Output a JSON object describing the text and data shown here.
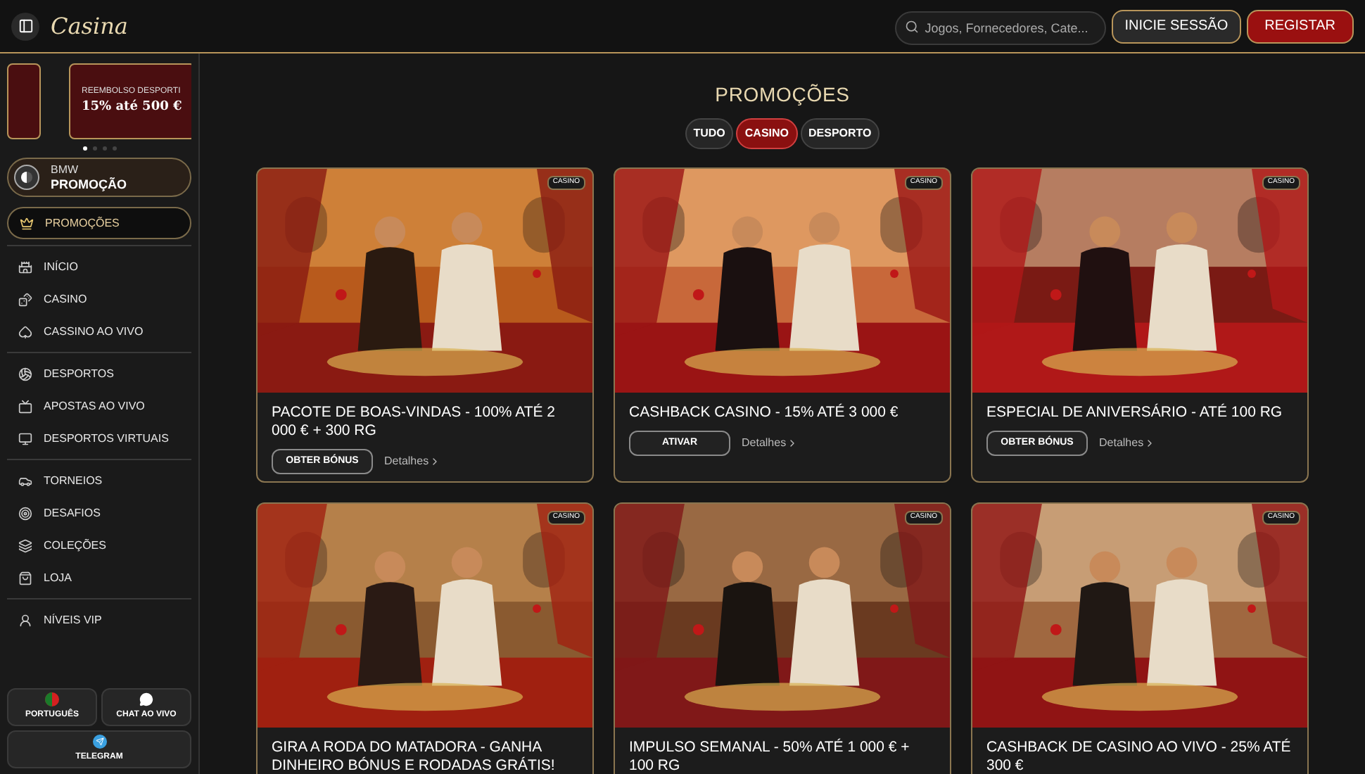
{
  "header": {
    "logo": "Casina",
    "search": {
      "placeholder": "Jogos, Fornecedores, Cate..."
    },
    "login": "INICIE SESSÃO",
    "register": "REGISTAR"
  },
  "sidebar": {
    "banners": [
      {
        "kind": "peek"
      },
      {
        "kind": "full",
        "title": "REEMBOLSO DESPORTI",
        "subtitle": "15% até 500 €"
      }
    ],
    "dots": [
      {
        "selected": true
      },
      {
        "selected": false
      },
      {
        "selected": false
      },
      {
        "selected": false
      }
    ],
    "bmw": {
      "line1": "BMW",
      "line2": "PROMOÇÃO"
    },
    "groups": [
      {
        "items": [
          {
            "kind": "promo",
            "label": "PROMOÇÕES",
            "selected": true
          }
        ]
      },
      {
        "items": [
          {
            "kind": "home",
            "label": "INÍCIO",
            "selected": false
          },
          {
            "kind": "casino",
            "label": "CASINO",
            "selected": false
          },
          {
            "kind": "live",
            "label": "CASSINO AO VIVO",
            "selected": false
          }
        ]
      },
      {
        "items": [
          {
            "kind": "sports",
            "label": "DESPORTOS",
            "selected": false
          },
          {
            "kind": "tv",
            "label": "APOSTAS AO VIVO",
            "selected": false
          },
          {
            "kind": "virtual",
            "label": "DESPORTOS VIRTUAIS",
            "selected": false
          }
        ]
      },
      {
        "items": [
          {
            "kind": "tournament",
            "label": "TORNEIOS",
            "selected": false
          },
          {
            "kind": "challenge",
            "label": "DESAFIOS",
            "selected": false
          },
          {
            "kind": "collection",
            "label": "COLEÇÕES",
            "selected": false
          },
          {
            "kind": "shop",
            "label": "LOJA",
            "selected": false
          }
        ]
      },
      {
        "items": [
          {
            "kind": "vip",
            "label": "NÍVEIS VIP",
            "selected": false
          }
        ]
      }
    ],
    "footer": [
      {
        "kind": "language",
        "label": "PORTUGUÊS"
      },
      {
        "kind": "chat",
        "label": "CHAT AO VIVO"
      },
      {
        "kind": "telegram",
        "label": "TELEGRAM"
      }
    ]
  },
  "main": {
    "title": "PROMOÇÕES",
    "filters": [
      {
        "label": "TUDO",
        "selected": false
      },
      {
        "label": "CASINO",
        "selected": true
      },
      {
        "label": "DESPORTO",
        "selected": false
      }
    ],
    "promos": [
      {
        "tag": "CASINO",
        "title": "PACOTE DE BOAS-VINDAS - 100% ATÉ 2 000 € + 300 RG",
        "action": "OBTER BÓNUS",
        "details": "Detalhes"
      },
      {
        "tag": "CASINO",
        "title": "CASHBACK CASINO - 15% ATÉ 3 000 €",
        "action": "ATIVAR",
        "details": "Detalhes"
      },
      {
        "tag": "CASINO",
        "title": "ESPECIAL DE ANIVERSÁRIO - ATÉ 100 RG",
        "action": "OBTER BÓNUS",
        "details": "Detalhes"
      },
      {
        "tag": "CASINO",
        "title": "GIRA A RODA DO MATADORA - GANHA DINHEIRO BÓNUS E RODADAS GRÁTIS!"
      },
      {
        "tag": "CASINO",
        "title": "IMPULSO SEMANAL - 50% ATÉ 1 000 € + 100 RG"
      },
      {
        "tag": "CASINO",
        "title": "CASHBACK DE CASINO AO VIVO - 25% ATÉ 300 €"
      }
    ]
  }
}
